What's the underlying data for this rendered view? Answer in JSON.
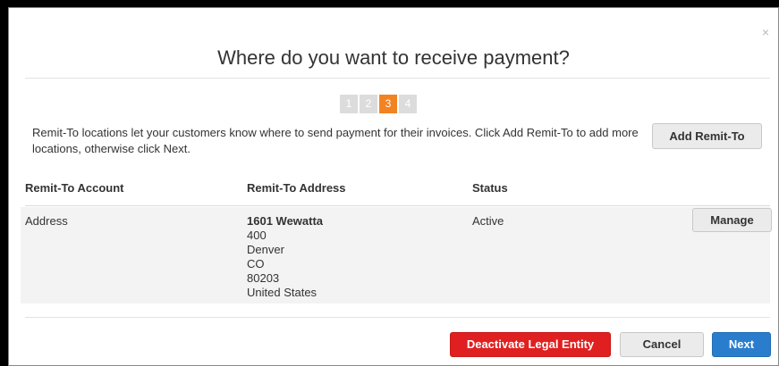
{
  "dialog": {
    "title": "Where do you want to receive payment?",
    "close_label": "×"
  },
  "steps": [
    {
      "label": "1",
      "active": false
    },
    {
      "label": "2",
      "active": false
    },
    {
      "label": "3",
      "active": true
    },
    {
      "label": "4",
      "active": false
    }
  ],
  "description": "Remit-To locations let your customers know where to send payment for their invoices. Click Add Remit-To to add more locations, otherwise click Next.",
  "add_button_label": "Add Remit-To",
  "table": {
    "headers": [
      "Remit-To Account",
      "Remit-To Address",
      "Status"
    ],
    "rows": [
      {
        "account": "Address",
        "address": {
          "street": "1601 Wewatta",
          "line2": "400",
          "city": "Denver",
          "state": "CO",
          "zip": "80203",
          "country": "United States"
        },
        "status": "Active",
        "action_label": "Manage"
      }
    ]
  },
  "footer": {
    "deactivate_label": "Deactivate Legal Entity",
    "cancel_label": "Cancel",
    "next_label": "Next"
  },
  "colors": {
    "active_step": "#f28322",
    "inactive_step": "#dcdcdc",
    "danger": "#e02020",
    "primary": "#2a7dcc"
  }
}
